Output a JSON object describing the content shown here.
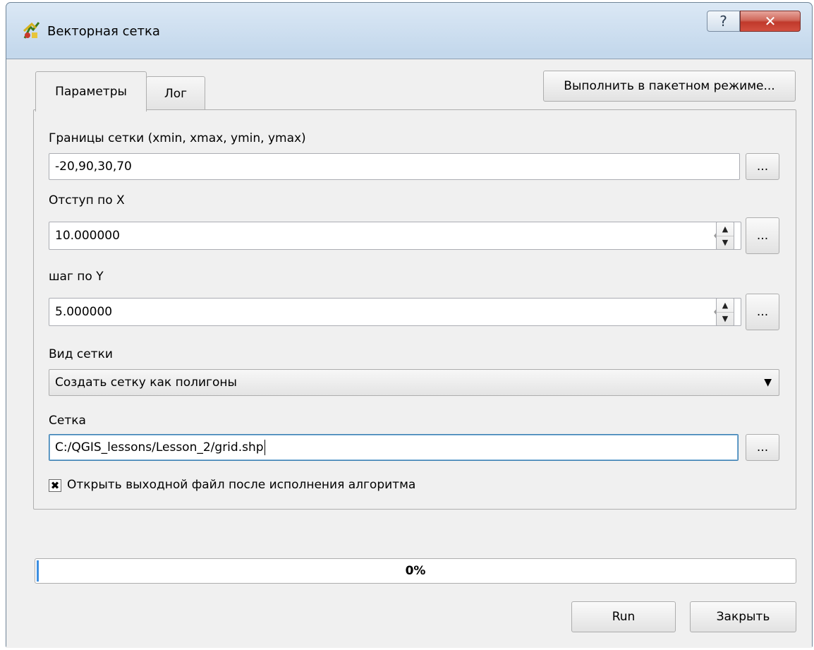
{
  "window": {
    "title": "Векторная сетка"
  },
  "titlebar": {
    "help_glyph": "?",
    "close_glyph": "✕"
  },
  "tabs": [
    {
      "label": "Параметры",
      "active": true
    },
    {
      "label": "Лог",
      "active": false
    }
  ],
  "batch_button_label": "Выполнить в пакетном режиме...",
  "params": {
    "extent": {
      "label": "Границы сетки (xmin, xmax, ymin, ymax)",
      "value": "-20,90,30,70",
      "browse_label": "..."
    },
    "spacing_x": {
      "label": "Отступ по X",
      "value": "10.000000",
      "browse_label": "..."
    },
    "spacing_y": {
      "label": "шаг по Y",
      "value": "5.000000",
      "browse_label": "..."
    },
    "grid_type": {
      "label": "Вид сетки",
      "value": "Создать сетку как полигоны"
    },
    "output": {
      "label": "Сетка",
      "value": "C:/QGIS_lessons/Lesson_2/grid.shp",
      "browse_label": "..."
    },
    "open_after": {
      "label": "Открыть выходной файл после исполнения алгоритма",
      "checked": true
    }
  },
  "progress": {
    "text": "0%",
    "value": 0
  },
  "buttons": {
    "run": "Run",
    "close": "Закрыть"
  },
  "colors": {
    "progress_fill": "#3d8ee0",
    "close_button": "#c0392b",
    "focus_border": "#3c7fb1"
  },
  "icons": {
    "app": "qgis-grid-icon",
    "clear": "clear-text-icon",
    "spin_up": "arrow-up-icon",
    "spin_down": "arrow-down-icon",
    "combo": "chevron-down-icon",
    "check": "check-mark-icon"
  }
}
